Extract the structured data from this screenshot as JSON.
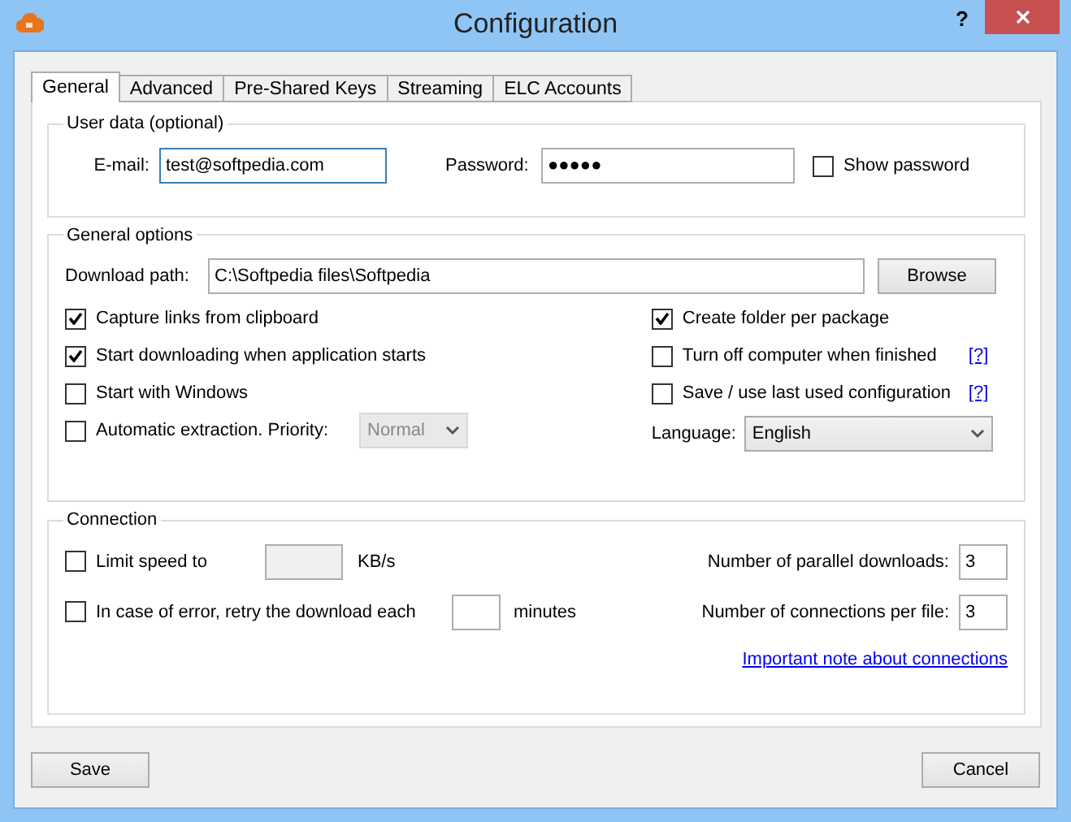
{
  "window": {
    "title": "Configuration",
    "help": "?"
  },
  "tabs": [
    {
      "label": "General",
      "selected": true
    },
    {
      "label": "Advanced",
      "selected": false
    },
    {
      "label": "Pre-Shared Keys",
      "selected": false
    },
    {
      "label": "Streaming",
      "selected": false
    },
    {
      "label": "ELC Accounts",
      "selected": false
    }
  ],
  "user_data": {
    "legend": "User data (optional)",
    "email": {
      "label": "E-mail:",
      "value": "test@softpedia.com",
      "focused": true
    },
    "password": {
      "label": "Password:",
      "value": "●●●●●"
    },
    "show_password": {
      "label": "Show password",
      "checked": false
    }
  },
  "general_options": {
    "legend": "General options",
    "download_path": {
      "label": "Download path:",
      "value": "C:\\Softpedia files\\Softpedia"
    },
    "browse_button": "Browse",
    "left_options": [
      {
        "label": "Capture links from clipboard",
        "checked": true
      },
      {
        "label": "Start downloading when application starts",
        "checked": true
      },
      {
        "label": "Start with Windows",
        "checked": false
      },
      {
        "label": "Automatic extraction. Priority:",
        "checked": false
      }
    ],
    "priority": {
      "value": "Normal",
      "disabled": true
    },
    "right_options": [
      {
        "label": "Create folder per package",
        "checked": true
      },
      {
        "label": "Turn off computer when finished",
        "checked": false,
        "help": "[?]"
      },
      {
        "label": "Save / use last used configuration",
        "checked": false,
        "help": "[?]"
      }
    ],
    "language": {
      "label": "Language:",
      "value": "English"
    }
  },
  "connection": {
    "legend": "Connection",
    "limit_speed": {
      "label": "Limit speed to",
      "checked": false,
      "disabled": true,
      "unit": "KB/s"
    },
    "retry": {
      "label": "In case of error, retry the download each",
      "checked": false,
      "unit": "minutes"
    },
    "parallel_downloads": {
      "label": "Number of parallel downloads:",
      "value": "3"
    },
    "connections_per_file": {
      "label": "Number of connections per file:",
      "value": "3"
    },
    "note_link": "Important note about connections"
  },
  "buttons": [
    "Save",
    "Cancel"
  ]
}
